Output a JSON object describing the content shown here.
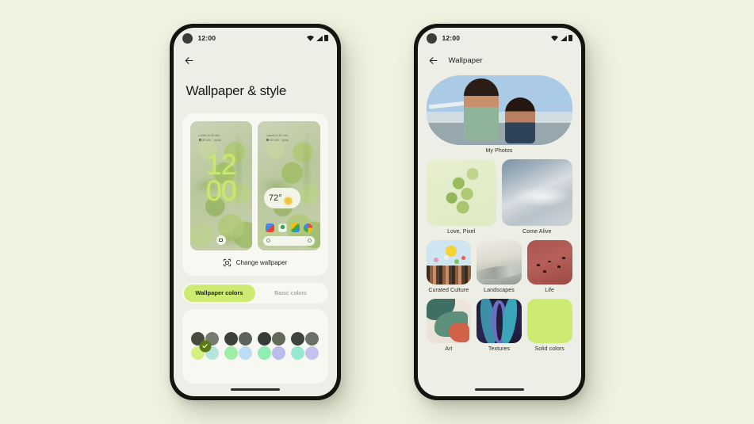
{
  "canvas": {
    "background": "#EFF2E0"
  },
  "left_phone": {
    "status_bar": {
      "time": "12:00",
      "icons": [
        "wifi-icon",
        "signal-icon",
        "battery-icon"
      ]
    },
    "app_bar": {
      "back_icon": "back-arrow-icon"
    },
    "page_title": "Wallpaper & style",
    "preview": {
      "lock_screen": {
        "meta_line_1": "Lunch in 30 min",
        "meta_line_2": "30 min · zoom",
        "clock_hours": "12",
        "clock_minutes": "00",
        "bottom_button_icon": "camera-icon"
      },
      "home_screen": {
        "meta_line_1": "Lunch in 30 min",
        "meta_line_2": "30 min · zoom",
        "weather_temp": "72°",
        "weather_icon": "sun-icon",
        "dock_icons": [
          "gmail-icon",
          "photos-icon",
          "maps-icon",
          "chrome-icon"
        ],
        "search_bar_left_icon": "google-g-icon",
        "search_bar_right_icon": "mic-icon"
      }
    },
    "change_wallpaper": {
      "label": "Change wallpaper",
      "icon": "wallpaper-icon"
    },
    "segmented_control": {
      "options": [
        {
          "label": "Wallpaper colors",
          "active": true
        },
        {
          "label": "Basic colors",
          "active": false
        }
      ],
      "active_background": "#CCEB70"
    },
    "color_swatches": {
      "selected_index": 0,
      "check_color": "#5C7A14",
      "items": [
        {
          "name": "swatch-1",
          "selected": true,
          "colors": [
            "#4A4A40",
            "#777C6E",
            "#D6F07E",
            "#B5E4DC"
          ]
        },
        {
          "name": "swatch-2",
          "selected": false,
          "colors": [
            "#3B4238",
            "#5C6358",
            "#9BF0A4",
            "#BBDCF2"
          ]
        },
        {
          "name": "swatch-3",
          "selected": false,
          "colors": [
            "#353D34",
            "#626A5E",
            "#8DEFB4",
            "#B9BDEE"
          ]
        },
        {
          "name": "swatch-4",
          "selected": false,
          "colors": [
            "#3E463C",
            "#6A7166",
            "#95E9D0",
            "#C6C2F0"
          ]
        }
      ]
    },
    "home_indicator": "home-indicator"
  },
  "right_phone": {
    "status_bar": {
      "time": "12:00",
      "icons": [
        "wifi-icon",
        "signal-icon",
        "battery-icon"
      ]
    },
    "app_bar": {
      "back_icon": "back-arrow-icon",
      "title": "Wallpaper"
    },
    "categories": {
      "featured": {
        "label": "My Photos",
        "thumb": "photo-two-boys"
      },
      "rows": [
        [
          {
            "label": "Love, Pixel",
            "thumb": "green-botanical"
          },
          {
            "label": "Come Alive",
            "thumb": "blue-grey-abstract"
          }
        ],
        [
          {
            "label": "Curated Culture",
            "thumb": "hands-flowers-illustration"
          },
          {
            "label": "Landscapes",
            "thumb": "muted-landscape"
          },
          {
            "label": "Life",
            "thumb": "red-birds"
          }
        ],
        [
          {
            "label": "Art",
            "thumb": "abstract-shapes"
          },
          {
            "label": "Textures",
            "thumb": "dark-blue-waves"
          },
          {
            "label": "Solid colors",
            "thumb": "solid-green"
          }
        ]
      ]
    },
    "home_indicator": "home-indicator"
  }
}
